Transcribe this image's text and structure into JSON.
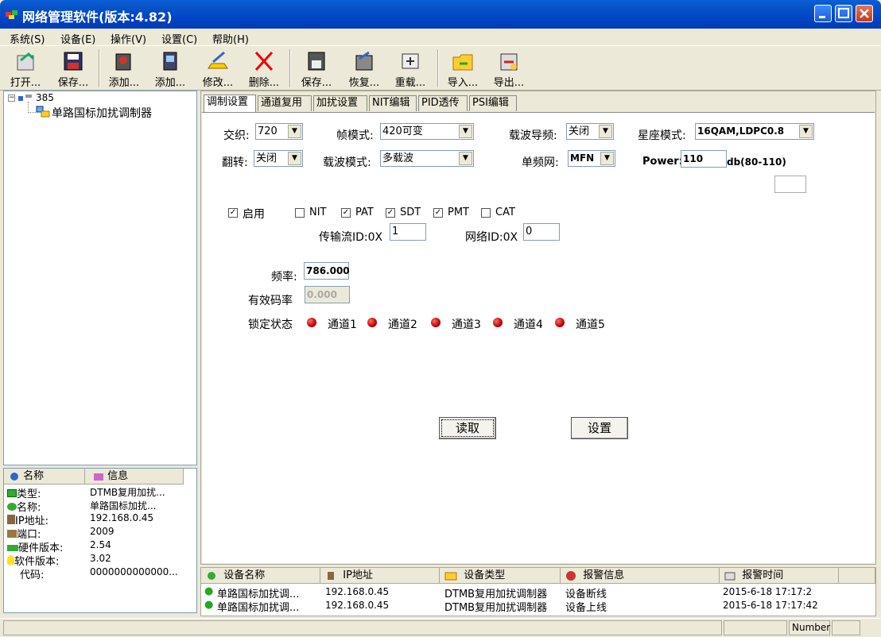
{
  "window": {
    "title": "网络管理软件(版本:4.82)"
  },
  "menu": [
    "系统(S)",
    "设备(E)",
    "操作(V)",
    "设置(C)",
    "帮助(H)"
  ],
  "toolbar": [
    "打开...",
    "保存...",
    "添加...",
    "添加...",
    "修改...",
    "删除...",
    "保存...",
    "恢复...",
    "重载...",
    "导入...",
    "导出..."
  ],
  "tree": {
    "root": "385",
    "child": "单路国标加扰调制器"
  },
  "info": {
    "headers": [
      "名称",
      "信息"
    ],
    "rows": [
      {
        "name": "类型:",
        "value": "DTMB复用加扰..."
      },
      {
        "name": "名称:",
        "value": "单路国标加扰..."
      },
      {
        "name": "IP地址:",
        "value": "192.168.0.45"
      },
      {
        "name": "端口:",
        "value": "2009"
      },
      {
        "name": "硬件版本:",
        "value": "2.54"
      },
      {
        "name": "软件版本:",
        "value": "3.02"
      },
      {
        "name": "代码:",
        "value": "0000000000000..."
      }
    ]
  },
  "tabs": [
    "调制设置",
    "通道复用",
    "加扰设置",
    "NIT编辑",
    "PID透传",
    "PSI编辑"
  ],
  "form": {
    "interleave_label": "交织:",
    "interleave": "720",
    "frame_label": "帧模式:",
    "frame": "420可变",
    "pilot_label": "载波导频:",
    "pilot": "关闭",
    "constellation_label": "星座模式:",
    "constellation": "16QAM,LDPC0.8",
    "flip_label": "翻转:",
    "flip": "关闭",
    "carrier_label": "载波模式:",
    "carrier": "多载波",
    "sfn_label": "单频网:",
    "sfn": "MFN",
    "power_label": "Power:",
    "power": "110",
    "power_unit": "db(80-110)",
    "enable_label": "启用",
    "tables": [
      {
        "label": "NIT",
        "checked": ""
      },
      {
        "label": "PAT",
        "checked": "✓"
      },
      {
        "label": "SDT",
        "checked": "✓"
      },
      {
        "label": "PMT",
        "checked": "✓"
      },
      {
        "label": "CAT",
        "checked": ""
      }
    ],
    "enable_check": "✓",
    "ts_id_label": "传输流ID:0X",
    "ts_id": "1",
    "net_id_label": "网络ID:0X",
    "net_id": "0",
    "freq_label": "频率:",
    "freq": "786.000",
    "rate_label": "有效码率",
    "rate": "0.000",
    "lock_label": "锁定状态",
    "channels": [
      "通道1",
      "通道2",
      "通道3",
      "通道4",
      "通道5"
    ],
    "read_button": "读取",
    "set_button": "设置"
  },
  "alarm": {
    "headers": [
      "设备名称",
      "IP地址",
      "设备类型",
      "报警信息",
      "报警时间"
    ],
    "rows": [
      [
        "单路国标加扰调...",
        "192.168.0.45",
        "DTMB复用加扰调制器",
        "设备断线",
        "2015-6-18 17:17:2"
      ],
      [
        "单路国标加扰调...",
        "192.168.0.45",
        "DTMB复用加扰调制器",
        "设备上线",
        "2015-6-18 17:17:42"
      ]
    ]
  },
  "status": {
    "number": "Number"
  }
}
